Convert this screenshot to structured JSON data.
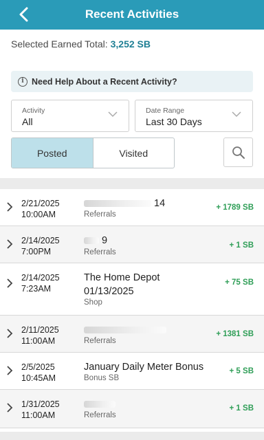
{
  "header": {
    "title": "Recent Activities",
    "back_icon": "chevron-left-icon"
  },
  "earned": {
    "label": "Selected Earned Total:",
    "value": "3,252 SB"
  },
  "help": {
    "icon": "info-icon",
    "text": "Need Help About a Recent Activity?"
  },
  "filters": {
    "activity": {
      "label": "Activity",
      "value": "All"
    },
    "date_range": {
      "label": "Date Range",
      "value": "Last 30 Days"
    }
  },
  "tabs": {
    "posted": "Posted",
    "visited": "Visited",
    "active": "posted"
  },
  "search": {
    "icon": "search-icon"
  },
  "colors": {
    "header": "#2a9bb8",
    "points": "#2f9e57",
    "active_tab": "#bde0ea",
    "total": "#1f7f94"
  },
  "activities": [
    {
      "date": "2/21/2025",
      "time": "10:00AM",
      "title": "14",
      "category": "Referrals",
      "points": "+ 1789 SB"
    },
    {
      "date": "2/14/2025",
      "time": "7:00PM",
      "title": "9",
      "category": "Referrals",
      "points": "+ 1 SB"
    },
    {
      "date": "2/14/2025",
      "time": "7:23AM",
      "title": "The Home Depot",
      "title2": "01/13/2025",
      "category": "Shop",
      "points": "+ 75 SB"
    },
    {
      "date": "2/11/2025",
      "time": "11:00AM",
      "title": "",
      "category": "Referrals",
      "points": "+ 1381 SB"
    },
    {
      "date": "2/5/2025",
      "time": "10:45AM",
      "title": "January Daily Meter Bonus",
      "category": "Bonus SB",
      "points": "+ 5 SB"
    },
    {
      "date": "1/31/2025",
      "time": "11:00AM",
      "title": "",
      "category": "Referrals",
      "points": "+ 1 SB"
    }
  ]
}
